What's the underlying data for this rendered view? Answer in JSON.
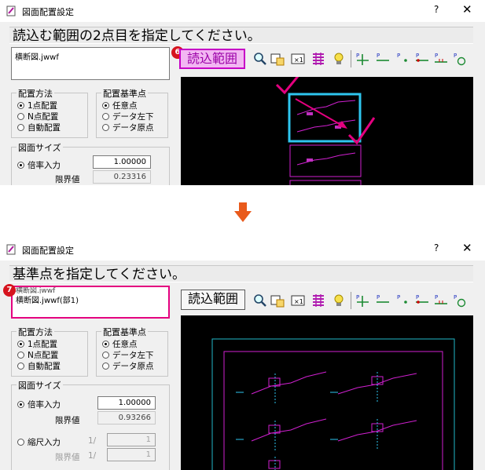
{
  "window_title": "図面配置設定",
  "help_label": "?",
  "close_label": "✕",
  "arrow_icon": "down-arrow-icon",
  "accent_color": "#e4007f",
  "step1": {
    "badge": "6",
    "prompt": "読込む範囲の2点目を指定してください。",
    "file_item": "横断図.jwwf",
    "load_button": "読込範囲",
    "placement_title": "配置方法",
    "placement_options": [
      "1点配置",
      "N点配置",
      "自動配置"
    ],
    "base_title": "配置基準点",
    "base_options": [
      "任意点",
      "データ左下",
      "データ原点"
    ],
    "size_title": "図面サイズ",
    "scale_label": "倍率入力",
    "scale_value": "1.00000",
    "limit_label": "限界値",
    "limit_value": "0.23316"
  },
  "step2": {
    "badge": "7",
    "prompt": "基準点を指定してください。",
    "file_item": "横断図.jwwf(部1)",
    "file_item_partial": "横断図.jwwf",
    "load_button": "読込範囲",
    "placement_title": "配置方法",
    "placement_options": [
      "1点配置",
      "N点配置",
      "自動配置"
    ],
    "base_title": "配置基準点",
    "base_options": [
      "任意点",
      "データ左下",
      "データ原点"
    ],
    "size_title": "図面サイズ",
    "scale_label": "倍率入力",
    "scale_value": "1.00000",
    "limit_label": "限界値",
    "limit_value": "0.93266",
    "reduce_label": "縮尺入力",
    "reduce_prefix": "1/",
    "reduce_value": "1",
    "reduce_limit_label": "限界値",
    "reduce_limit_prefix": "1/",
    "reduce_limit_value": "1"
  },
  "toolbar_icons": [
    "zoom-icon",
    "fit-window-icon",
    "scale-x1-icon",
    "layer-icon",
    "bulb-icon",
    "point-cross-icon",
    "point-line-icon",
    "point-dot-icon",
    "point-end-icon",
    "point-mid-icon",
    "point-circle-icon"
  ]
}
